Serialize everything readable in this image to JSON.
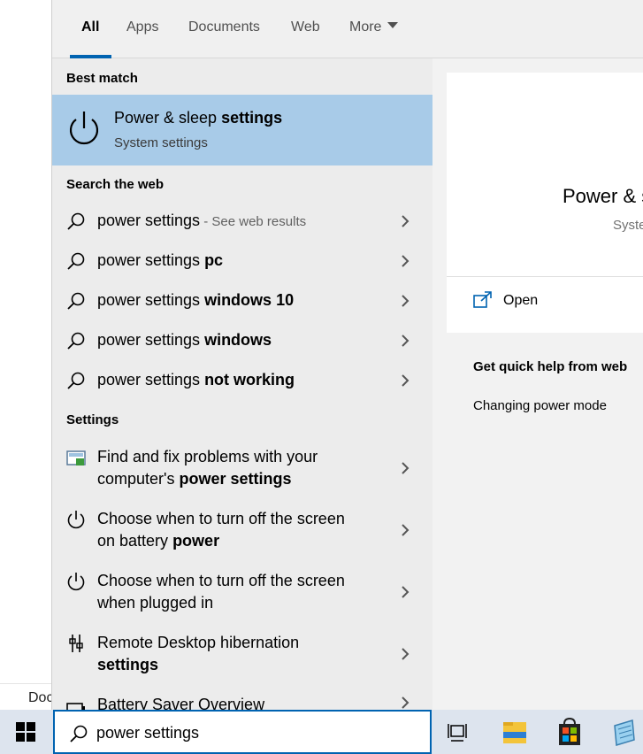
{
  "background": {
    "doc_label": "Doc"
  },
  "tabs": [
    {
      "label": "All"
    },
    {
      "label": "Apps"
    },
    {
      "label": "Documents"
    },
    {
      "label": "Web"
    },
    {
      "label": "More"
    }
  ],
  "best_match": {
    "heading": "Best match",
    "title_pre": "Power & sleep ",
    "title_bold": "settings",
    "subtitle": "System settings"
  },
  "web": {
    "heading": "Search the web",
    "items": [
      {
        "plain": "power settings",
        "bold": "",
        "suffix": " - See web results"
      },
      {
        "plain": "power settings ",
        "bold": "pc",
        "suffix": ""
      },
      {
        "plain": "power settings ",
        "bold": "windows 10",
        "suffix": ""
      },
      {
        "plain": "power settings ",
        "bold": "windows",
        "suffix": ""
      },
      {
        "plain": "power settings ",
        "bold": "not working",
        "suffix": ""
      }
    ]
  },
  "settings": {
    "heading": "Settings",
    "items": [
      {
        "line1": "Find and fix problems with your",
        "line2_pre": "computer's ",
        "line2_bold": "power settings",
        "icon": "troubleshoot-icon"
      },
      {
        "line1": "Choose when to turn off the screen",
        "line2_pre": "on battery ",
        "line2_bold": "power",
        "icon": "power-icon"
      },
      {
        "line1": "Choose when to turn off the screen",
        "line2_pre": "when plugged in",
        "line2_bold": "",
        "icon": "power-icon"
      },
      {
        "line1": "Remote Desktop hibernation",
        "line2_pre": "",
        "line2_bold": "settings",
        "icon": "remote-desktop-icon"
      },
      {
        "line1": "Battery Saver Overview",
        "line2_pre": "",
        "line2_bold": "",
        "icon": "battery-icon"
      }
    ]
  },
  "preview": {
    "title": "Power & sleep settings",
    "subtitle": "System settings",
    "open_label": "Open",
    "help_heading": "Get quick help from web",
    "help_links": [
      "Changing power mode"
    ]
  },
  "taskbar": {
    "search_value": "power settings",
    "icons": [
      "task-view-icon",
      "file-explorer-icon",
      "store-icon",
      "notepad-icon"
    ]
  },
  "colors": {
    "accent": "#0063b1",
    "highlight": "#a8cbe8",
    "panel": "#f0f0f0"
  }
}
